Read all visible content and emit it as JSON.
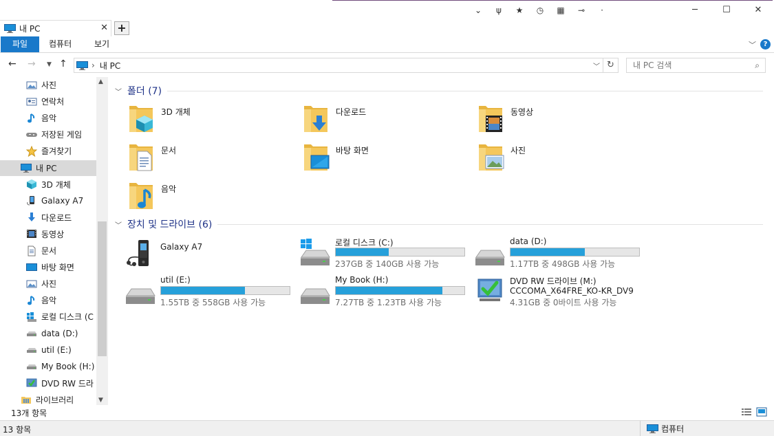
{
  "window": {
    "title_icons": [
      "chevron-double-down-icon",
      "pitchfork-icon",
      "star-icon",
      "clock-icon",
      "grid-icon",
      "pin-icon",
      "dot-icon"
    ],
    "controls": {
      "minimize": "─",
      "maximize": "☐",
      "close": "✕"
    }
  },
  "tabs": {
    "active": {
      "title": "내 PC",
      "close": "✕"
    },
    "new_tab": "+"
  },
  "ribbon": {
    "file": "파일",
    "computer": "컴퓨터",
    "view": "보기",
    "help": "?"
  },
  "address": {
    "path": "내 PC",
    "separator": "›",
    "search_placeholder": "내 PC 검색"
  },
  "nav_pane": {
    "items": [
      {
        "label": "사진",
        "icon": "pictures-icon"
      },
      {
        "label": "연락처",
        "icon": "contacts-icon"
      },
      {
        "label": "음악",
        "icon": "music-icon"
      },
      {
        "label": "저장된 게임",
        "icon": "saved-games-icon"
      },
      {
        "label": "즐겨찾기",
        "icon": "favorites-icon"
      },
      {
        "label": "내 PC",
        "icon": "this-pc-icon",
        "selected": true
      },
      {
        "label": "3D 개체",
        "icon": "3d-objects-icon"
      },
      {
        "label": "Galaxy A7",
        "icon": "phone-icon"
      },
      {
        "label": "다운로드",
        "icon": "downloads-icon"
      },
      {
        "label": "동영상",
        "icon": "videos-icon"
      },
      {
        "label": "문서",
        "icon": "documents-icon"
      },
      {
        "label": "바탕 화면",
        "icon": "desktop-icon"
      },
      {
        "label": "사진",
        "icon": "pictures-icon"
      },
      {
        "label": "음악",
        "icon": "music-icon"
      },
      {
        "label": "로컬 디스크 (C",
        "icon": "local-disk-icon"
      },
      {
        "label": "data (D:)",
        "icon": "drive-icon"
      },
      {
        "label": "util (E:)",
        "icon": "drive-icon"
      },
      {
        "label": "My Book (H:)",
        "icon": "drive-icon"
      },
      {
        "label": "DVD RW 드라",
        "icon": "dvd-icon"
      },
      {
        "label": "라이브러리",
        "icon": "libraries-icon"
      }
    ]
  },
  "folders_group": {
    "title": "폴더 (7)",
    "items": [
      {
        "label": "3D 개체",
        "overlay": "3d-cube"
      },
      {
        "label": "다운로드",
        "overlay": "download-arrow"
      },
      {
        "label": "동영상",
        "overlay": "film"
      },
      {
        "label": "문서",
        "overlay": "document"
      },
      {
        "label": "바탕 화면",
        "overlay": "desktop"
      },
      {
        "label": "사진",
        "overlay": "picture"
      },
      {
        "label": "음악",
        "overlay": "music-note"
      }
    ]
  },
  "devices_group": {
    "title": "장치 및 드라이브 (6)",
    "items": [
      {
        "name": "Galaxy A7",
        "type": "phone"
      },
      {
        "name": "로컬 디스크 (C:)",
        "type": "windows-drive",
        "info": "237GB 중 140GB 사용 가능",
        "used_fraction": 0.41
      },
      {
        "name": "data (D:)",
        "type": "drive",
        "info": "1.17TB 중 498GB 사용 가능",
        "used_fraction": 0.58
      },
      {
        "name": "util (E:)",
        "type": "drive",
        "info": "1.55TB 중 558GB 사용 가능",
        "used_fraction": 0.65
      },
      {
        "name": "My Book (H:)",
        "type": "drive",
        "info": "7.27TB 중 1.23TB 사용 가능",
        "used_fraction": 0.83
      },
      {
        "name": "DVD RW 드라이브 (M:)",
        "type": "dvd",
        "sub": "CCCOMA_X64FRE_KO-KR_DV9",
        "info": "4.31GB 중 0바이트 사용 가능"
      }
    ]
  },
  "status": {
    "pane_count": "13개 항목",
    "bar_count": "13 항목",
    "location": "컴퓨터"
  },
  "colors": {
    "accent": "#1979ca",
    "bar_fill": "#26a0da",
    "folder": "#f4c75b",
    "group_title": "#1e3287"
  }
}
